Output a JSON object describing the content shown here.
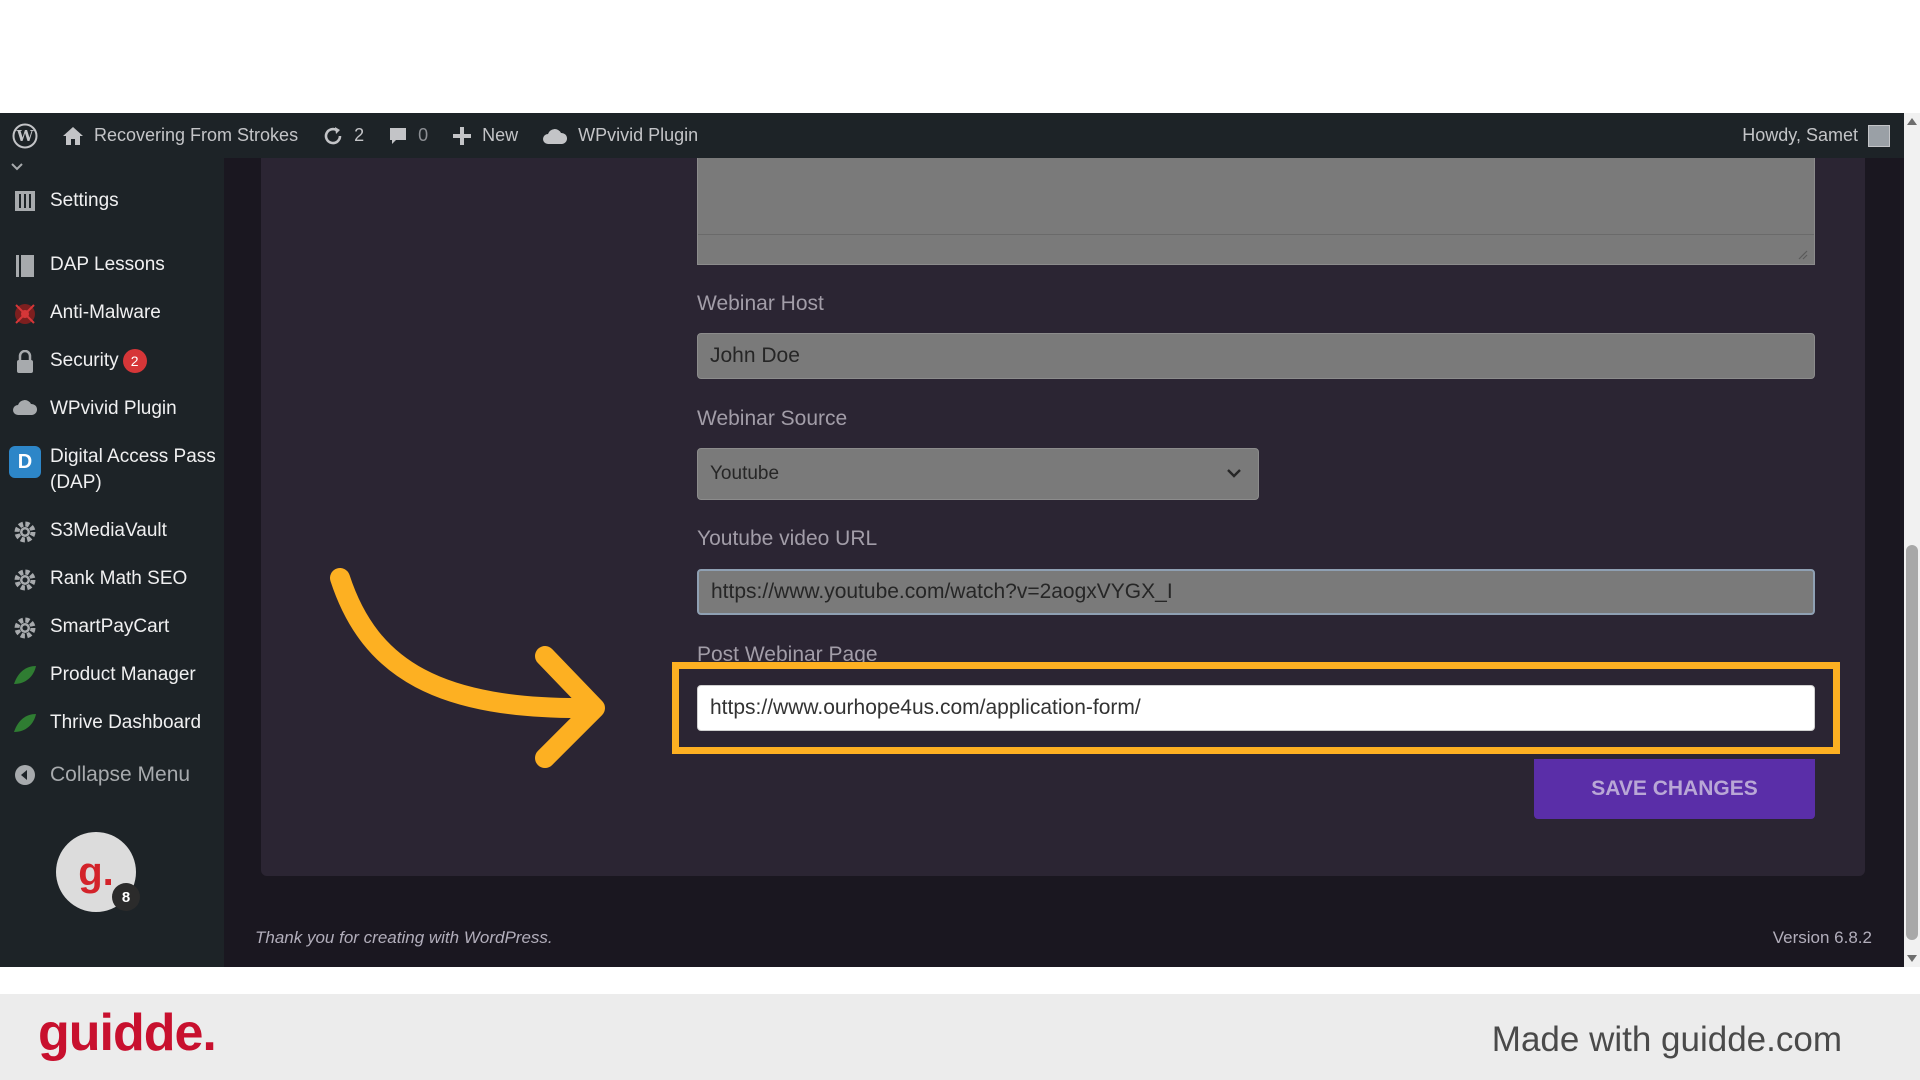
{
  "admin_bar": {
    "site_name": "Recovering From Strokes",
    "updates_count": "2",
    "comments_count": "0",
    "new_label": "New",
    "plugin_label": "WPvivid Plugin",
    "greeting": "Howdy, Samet"
  },
  "sidebar": {
    "items": [
      {
        "label": "Settings",
        "icon": "settings-icon"
      },
      {
        "label": "DAP Lessons",
        "icon": "lessons-icon"
      },
      {
        "label": "Anti-Malware",
        "icon": "anti-malware-icon"
      },
      {
        "label": "Security",
        "icon": "lock-icon",
        "badge": "2"
      },
      {
        "label": "WPvivid Plugin",
        "icon": "cloud-icon"
      },
      {
        "label": "Digital Access Pass",
        "label2": "(DAP)",
        "icon": "dap-icon",
        "icon_text": "D"
      },
      {
        "label": "S3MediaVault",
        "icon": "gear-icon"
      },
      {
        "label": "Rank Math SEO",
        "icon": "gear-icon"
      },
      {
        "label": "SmartPayCart",
        "icon": "gear-icon"
      },
      {
        "label": "Product Manager",
        "icon": "leaf-icon"
      },
      {
        "label": "Thrive Dashboard",
        "icon": "leaf-icon"
      }
    ],
    "collapse_label": "Collapse Menu",
    "avatar_text": "g.",
    "avatar_badge": "8"
  },
  "form": {
    "webinar_host_label": "Webinar Host",
    "webinar_host_value": "John Doe",
    "webinar_source_label": "Webinar Source",
    "webinar_source_value": "Youtube",
    "youtube_url_label": "Youtube video URL",
    "youtube_url_value": "https://www.youtube.com/watch?v=2aogxVYGX_I",
    "post_webinar_label": "Post Webinar Page",
    "post_webinar_value": "https://www.ourhope4us.com/application-form/",
    "save_label": "SAVE CHANGES"
  },
  "footer": {
    "thanks": "Thank you for creating with WordPress.",
    "version": "Version 6.8.2"
  },
  "branding": {
    "logo": "guidde.",
    "made_with": "Made with guidde.com"
  },
  "colors": {
    "admin_bg": "#1d2327",
    "panel_bg": "#2b2533",
    "accent_purple": "#5a2ea8",
    "highlight": "#fdb022",
    "brand_red": "#c8102e"
  }
}
